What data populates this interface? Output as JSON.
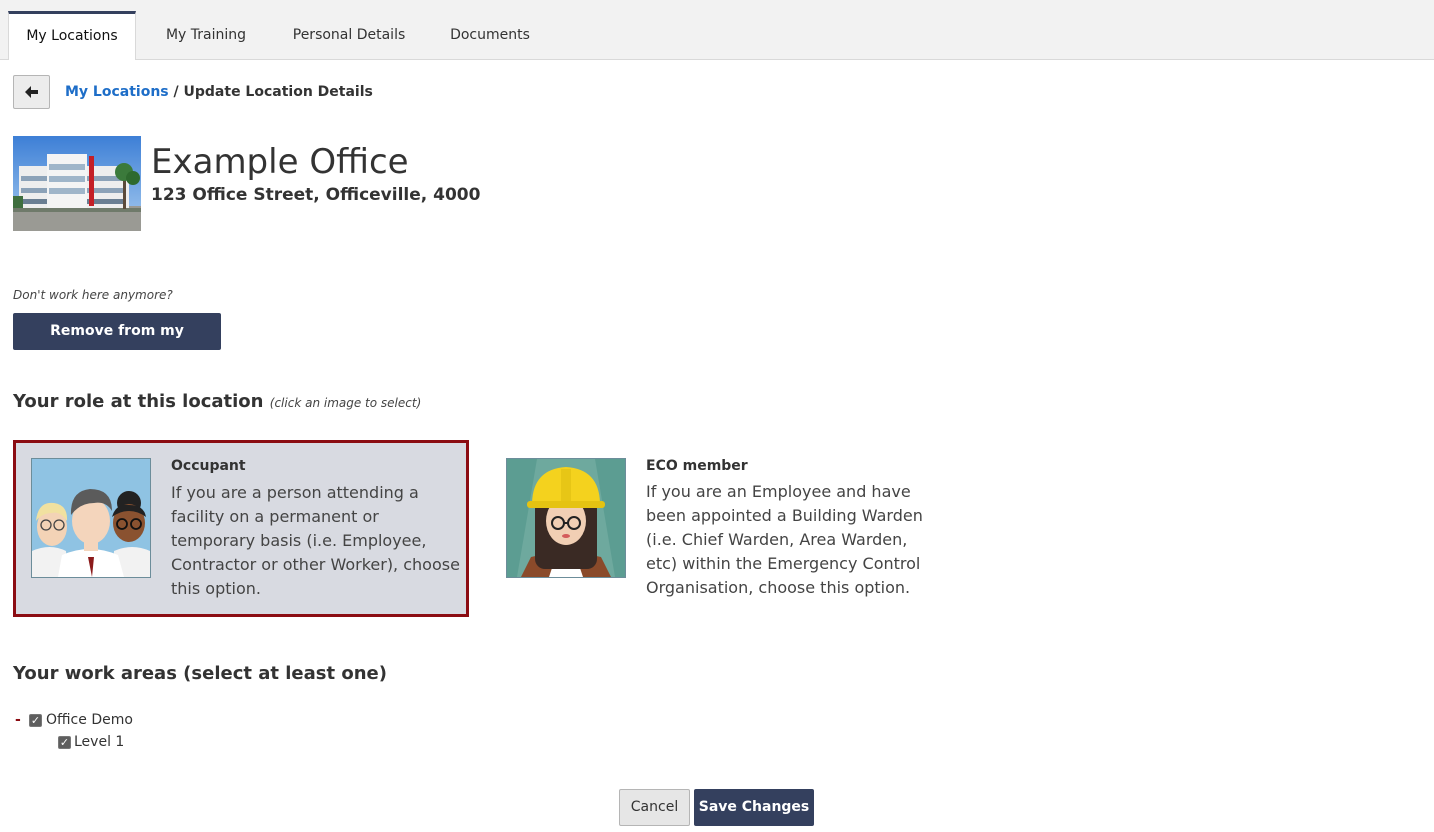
{
  "tabs": [
    {
      "label": "My Locations",
      "active": true
    },
    {
      "label": "My Training",
      "active": false
    },
    {
      "label": "Personal Details",
      "active": false
    },
    {
      "label": "Documents",
      "active": false
    }
  ],
  "breadcrumb": {
    "back_icon": "arrow-left-icon",
    "link": "My Locations",
    "separator": "/",
    "current": "Update Location Details"
  },
  "location": {
    "name": "Example Office",
    "address": "123 Office Street, Officeville, 4000"
  },
  "remove": {
    "hint": "Don't work here anymore?",
    "button_label": "Remove from my locations"
  },
  "role_section": {
    "heading": "Your role at this location",
    "hint": "(click an image to select)",
    "selected": "occupant",
    "roles": [
      {
        "id": "occupant",
        "title": "Occupant",
        "description": "If you are a person attending a facility on a permanent or temporary basis (i.e. Employee, Contractor or other Worker), choose this option."
      },
      {
        "id": "eco",
        "title": "ECO member",
        "description": "If you are an Employee and have been appointed a Building Warden (i.e. Chief Warden, Area Warden, etc) within the Emergency Control Organisation, choose this option."
      }
    ]
  },
  "work_areas": {
    "heading": "Your work areas (select at least one)",
    "toggle_symbol": "-",
    "items": [
      {
        "label": "Office Demo",
        "checked": true
      },
      {
        "label": "Level 1",
        "checked": true
      }
    ]
  },
  "actions": {
    "cancel_label": "Cancel",
    "save_label": "Save Changes"
  },
  "colors": {
    "primary": "#34405e",
    "selected_border": "#8b0c12",
    "link": "#1e6ec8"
  }
}
